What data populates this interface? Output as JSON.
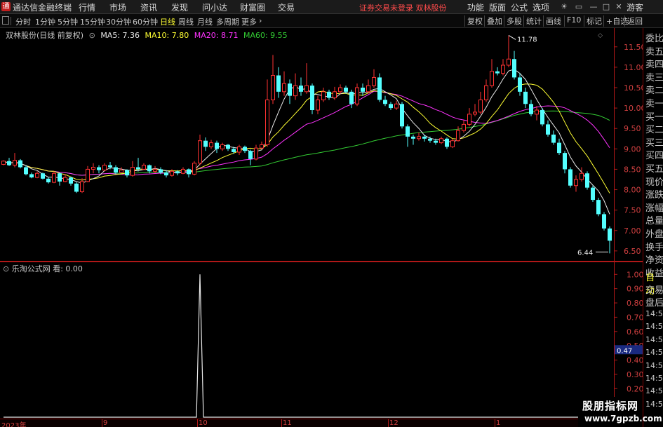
{
  "app": {
    "title": "通达信金融终端",
    "logo": "通"
  },
  "menu": [
    {
      "label": "行情",
      "id": "hq"
    },
    {
      "label": "市场",
      "id": "sc"
    },
    {
      "label": "资讯",
      "id": "zx"
    },
    {
      "label": "发现",
      "id": "fx"
    },
    {
      "label": "问小达",
      "id": "wxd"
    },
    {
      "label": "财富圈",
      "id": "cfq"
    },
    {
      "label": "交易",
      "id": "jy"
    }
  ],
  "notice": "证券交易未登录  双林股份",
  "right_menu": [
    "功能",
    "版面",
    "公式",
    "选项"
  ],
  "guest_label": "游客",
  "timeframes": [
    {
      "label": "分时"
    },
    {
      "label": "1分钟"
    },
    {
      "label": "5分钟"
    },
    {
      "label": "15分钟"
    },
    {
      "label": "30分钟"
    },
    {
      "label": "60分钟"
    },
    {
      "label": "日线",
      "active": true
    },
    {
      "label": "周线"
    },
    {
      "label": "月线"
    },
    {
      "label": "多周期"
    },
    {
      "label": "更多"
    }
  ],
  "toolbar_right": [
    "复权",
    "叠加",
    "多股",
    "统计",
    "画线",
    "F10",
    "标记",
    "+自选",
    "返回"
  ],
  "chart_header": {
    "stock": "双林股份(日线 前复权)",
    "ma5": "MA5: 7.36",
    "ma10": "MA10: 7.80",
    "ma20": "MA20: 8.71",
    "ma60": "MA60: 9.55"
  },
  "indicator_header": "乐淘公式网 看: 0.00",
  "colors": {
    "up": "#ff3232",
    "down": "#54ffff",
    "ma5": "#e8e8e8",
    "ma10": "#ffff33",
    "ma20": "#ff33ff",
    "ma60": "#33cc33",
    "axis": "#c02020"
  },
  "chart_data": {
    "type": "candlestick",
    "y_ticks": [
      6.5,
      7.0,
      7.5,
      8.0,
      8.5,
      9.0,
      9.5,
      10.0,
      10.5,
      11.0,
      11.5
    ],
    "ylim": [
      6.24,
      11.96
    ],
    "annotations": [
      {
        "label": "11.78",
        "price": 11.78,
        "bar": 90
      },
      {
        "label": "6.44",
        "price": 6.44,
        "bar": 108
      }
    ],
    "x_labels": [
      "2023年",
      "9",
      "10",
      "11",
      "12",
      "1"
    ],
    "candles": [
      [
        8.62,
        8.7,
        8.72,
        8.6
      ],
      [
        8.7,
        8.6,
        8.78,
        8.58
      ],
      [
        8.6,
        8.72,
        8.9,
        8.55
      ],
      [
        8.72,
        8.55,
        8.75,
        8.52
      ],
      [
        8.55,
        8.38,
        8.6,
        8.35
      ],
      [
        8.38,
        8.3,
        8.42,
        8.28
      ],
      [
        8.3,
        8.4,
        8.45,
        8.28
      ],
      [
        8.4,
        8.27,
        8.42,
        8.25
      ],
      [
        8.27,
        8.18,
        8.3,
        8.15
      ],
      [
        8.18,
        8.4,
        8.45,
        8.16
      ],
      [
        8.4,
        8.2,
        8.42,
        8.1
      ],
      [
        8.2,
        8.3,
        8.38,
        8.18
      ],
      [
        8.3,
        8.15,
        8.32,
        8.1
      ],
      [
        8.15,
        7.95,
        8.18,
        7.92
      ],
      [
        7.95,
        8.2,
        8.28,
        7.92
      ],
      [
        8.2,
        8.5,
        8.58,
        8.18
      ],
      [
        8.5,
        8.55,
        8.65,
        8.4
      ],
      [
        8.55,
        8.48,
        8.6,
        8.4
      ],
      [
        8.48,
        8.6,
        8.65,
        8.45
      ],
      [
        8.6,
        8.55,
        8.68,
        8.5
      ],
      [
        8.55,
        8.42,
        8.6,
        8.38
      ],
      [
        8.42,
        8.48,
        8.55,
        8.4
      ],
      [
        8.48,
        8.35,
        8.5,
        8.3
      ],
      [
        8.35,
        8.55,
        8.7,
        8.32
      ],
      [
        8.55,
        8.5,
        8.78,
        8.45
      ],
      [
        8.5,
        8.6,
        8.65,
        8.48
      ],
      [
        8.6,
        8.45,
        8.62,
        8.4
      ],
      [
        8.45,
        8.5,
        8.58,
        8.4
      ],
      [
        8.5,
        8.42,
        8.55,
        8.38
      ],
      [
        8.42,
        8.35,
        8.48,
        8.3
      ],
      [
        8.35,
        8.45,
        8.5,
        8.32
      ],
      [
        8.45,
        8.4,
        8.48,
        8.35
      ],
      [
        8.4,
        8.5,
        8.55,
        8.38
      ],
      [
        8.5,
        8.38,
        8.52,
        8.3
      ],
      [
        8.38,
        8.65,
        8.7,
        8.35
      ],
      [
        8.65,
        9.2,
        9.35,
        8.6
      ],
      [
        9.2,
        9.05,
        9.28,
        8.95
      ],
      [
        9.05,
        9.15,
        9.22,
        9.0
      ],
      [
        9.15,
        9.0,
        9.2,
        8.9
      ],
      [
        9.0,
        9.1,
        9.15,
        8.95
      ],
      [
        9.1,
        9.0,
        9.12,
        8.95
      ],
      [
        9.0,
        8.92,
        9.05,
        8.88
      ],
      [
        8.92,
        9.05,
        9.1,
        8.85
      ],
      [
        9.05,
        8.95,
        9.08,
        8.9
      ],
      [
        8.95,
        8.75,
        8.98,
        8.6
      ],
      [
        8.75,
        9.02,
        9.1,
        8.72
      ],
      [
        9.02,
        9.1,
        9.18,
        9.0
      ],
      [
        9.1,
        10.2,
        10.7,
        9.05
      ],
      [
        10.2,
        10.8,
        11.3,
        10.1
      ],
      [
        10.8,
        10.4,
        11.0,
        10.25
      ],
      [
        10.4,
        10.6,
        10.9,
        10.3
      ],
      [
        10.6,
        10.3,
        10.7,
        10.1
      ],
      [
        10.3,
        10.55,
        10.85,
        10.2
      ],
      [
        10.55,
        10.4,
        10.75,
        10.3
      ],
      [
        10.4,
        10.55,
        11.1,
        10.35
      ],
      [
        10.55,
        9.95,
        10.6,
        9.85
      ],
      [
        9.95,
        10.2,
        10.3,
        9.85
      ],
      [
        10.2,
        10.4,
        10.5,
        10.15
      ],
      [
        10.4,
        10.25,
        10.45,
        10.2
      ],
      [
        10.25,
        10.4,
        10.52,
        10.2
      ],
      [
        10.4,
        10.5,
        10.58,
        10.35
      ],
      [
        10.5,
        10.4,
        10.55,
        10.35
      ],
      [
        10.4,
        10.1,
        10.45,
        10.0
      ],
      [
        10.1,
        10.5,
        10.6,
        10.05
      ],
      [
        10.5,
        10.4,
        10.6,
        10.3
      ],
      [
        10.4,
        10.55,
        10.7,
        10.35
      ],
      [
        10.55,
        10.75,
        10.95,
        10.5
      ],
      [
        10.75,
        10.2,
        10.85,
        10.15
      ],
      [
        10.2,
        10.1,
        10.3,
        10.05
      ],
      [
        10.1,
        10.0,
        10.15,
        9.95
      ],
      [
        10.0,
        10.1,
        10.18,
        9.95
      ],
      [
        10.1,
        9.55,
        10.15,
        9.5
      ],
      [
        9.55,
        9.3,
        9.6,
        9.05
      ],
      [
        9.3,
        9.25,
        9.35,
        9.1
      ],
      [
        9.25,
        9.3,
        9.4,
        9.2
      ],
      [
        9.3,
        9.25,
        9.35,
        9.18
      ],
      [
        9.25,
        9.2,
        9.3,
        9.15
      ],
      [
        9.2,
        9.15,
        9.25,
        9.1
      ],
      [
        9.15,
        9.25,
        9.3,
        9.12
      ],
      [
        9.25,
        9.05,
        9.28,
        9.0
      ],
      [
        9.05,
        9.2,
        9.25,
        9.02
      ],
      [
        9.2,
        9.45,
        9.55,
        9.18
      ],
      [
        9.45,
        9.6,
        9.7,
        9.4
      ],
      [
        9.6,
        9.85,
        10.0,
        9.55
      ],
      [
        9.85,
        9.9,
        10.1,
        9.8
      ],
      [
        9.9,
        10.2,
        10.4,
        9.85
      ],
      [
        10.2,
        10.55,
        10.7,
        10.15
      ],
      [
        10.55,
        10.9,
        11.2,
        10.5
      ],
      [
        10.9,
        10.85,
        11.0,
        10.8
      ],
      [
        10.85,
        11.05,
        11.2,
        10.8
      ],
      [
        11.05,
        11.2,
        11.78,
        11.0
      ],
      [
        11.2,
        10.75,
        11.4,
        10.7
      ],
      [
        10.75,
        10.4,
        10.85,
        10.3
      ],
      [
        10.4,
        10.1,
        10.5,
        10.0
      ],
      [
        10.1,
        9.85,
        10.2,
        9.8
      ],
      [
        9.85,
        9.95,
        10.05,
        9.7
      ],
      [
        9.95,
        9.6,
        10.0,
        9.55
      ],
      [
        9.6,
        9.35,
        9.7,
        9.3
      ],
      [
        9.35,
        9.15,
        9.45,
        9.1
      ],
      [
        9.15,
        8.9,
        9.25,
        8.85
      ],
      [
        8.9,
        8.5,
        8.95,
        8.4
      ],
      [
        8.5,
        8.1,
        8.55,
        8.05
      ],
      [
        8.1,
        8.25,
        8.35,
        7.95
      ],
      [
        8.25,
        8.4,
        8.55,
        8.2
      ],
      [
        8.4,
        8.05,
        8.45,
        8.0
      ],
      [
        8.05,
        7.75,
        8.1,
        7.7
      ],
      [
        7.75,
        7.4,
        7.8,
        7.35
      ],
      [
        7.4,
        7.05,
        7.45,
        7.0
      ],
      [
        7.05,
        6.75,
        7.1,
        6.44
      ]
    ],
    "ma_end_values": {
      "MA5": 7.36,
      "MA10": 7.8,
      "MA20": 8.71,
      "MA60": 9.55
    },
    "indicator": {
      "name": "乐淘公式网",
      "series": "看",
      "last_value": 0.0,
      "y_ticks": [
        0.1,
        0.2,
        0.3,
        0.4,
        0.5,
        0.6,
        0.7,
        0.8,
        0.9,
        1.0
      ],
      "ylim": [
        0,
        1.08
      ],
      "spike_bar": 35,
      "spike_value": 1.0
    }
  },
  "right_panel": {
    "labels": [
      "委比",
      "卖五",
      "卖四",
      "卖三",
      "卖二",
      "卖一",
      "买一",
      "买二",
      "买三",
      "买四",
      "买五",
      "现价",
      "涨跌",
      "涨幅",
      "总量",
      "外盘",
      "换手",
      "净资",
      "收益"
    ],
    "auto_label": "自动",
    "lower_labels": [
      "交易",
      "盘后"
    ],
    "times": [
      "14:56",
      "14:56",
      "14:56",
      "14:56",
      "14:56",
      "14:56",
      "14:57",
      "14:57"
    ],
    "highlight_value": "0.47"
  },
  "watermark": {
    "line1": "股朋指标网",
    "line2": "www.7gpzb.com"
  }
}
